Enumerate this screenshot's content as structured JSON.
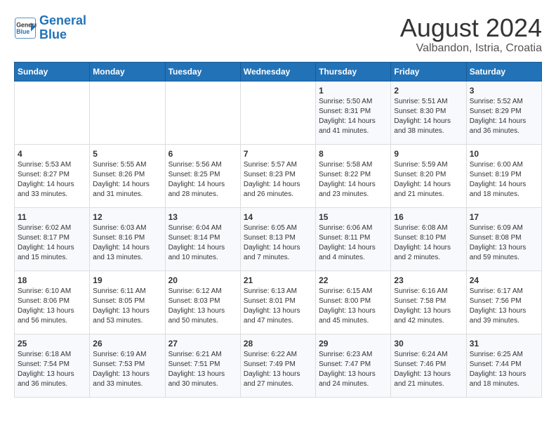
{
  "header": {
    "logo_line1": "General",
    "logo_line2": "Blue",
    "title": "August 2024",
    "subtitle": "Valbandon, Istria, Croatia"
  },
  "weekdays": [
    "Sunday",
    "Monday",
    "Tuesday",
    "Wednesday",
    "Thursday",
    "Friday",
    "Saturday"
  ],
  "weeks": [
    [
      {
        "day": "",
        "content": ""
      },
      {
        "day": "",
        "content": ""
      },
      {
        "day": "",
        "content": ""
      },
      {
        "day": "",
        "content": ""
      },
      {
        "day": "1",
        "content": "Sunrise: 5:50 AM\nSunset: 8:31 PM\nDaylight: 14 hours\nand 41 minutes."
      },
      {
        "day": "2",
        "content": "Sunrise: 5:51 AM\nSunset: 8:30 PM\nDaylight: 14 hours\nand 38 minutes."
      },
      {
        "day": "3",
        "content": "Sunrise: 5:52 AM\nSunset: 8:29 PM\nDaylight: 14 hours\nand 36 minutes."
      }
    ],
    [
      {
        "day": "4",
        "content": "Sunrise: 5:53 AM\nSunset: 8:27 PM\nDaylight: 14 hours\nand 33 minutes."
      },
      {
        "day": "5",
        "content": "Sunrise: 5:55 AM\nSunset: 8:26 PM\nDaylight: 14 hours\nand 31 minutes."
      },
      {
        "day": "6",
        "content": "Sunrise: 5:56 AM\nSunset: 8:25 PM\nDaylight: 14 hours\nand 28 minutes."
      },
      {
        "day": "7",
        "content": "Sunrise: 5:57 AM\nSunset: 8:23 PM\nDaylight: 14 hours\nand 26 minutes."
      },
      {
        "day": "8",
        "content": "Sunrise: 5:58 AM\nSunset: 8:22 PM\nDaylight: 14 hours\nand 23 minutes."
      },
      {
        "day": "9",
        "content": "Sunrise: 5:59 AM\nSunset: 8:20 PM\nDaylight: 14 hours\nand 21 minutes."
      },
      {
        "day": "10",
        "content": "Sunrise: 6:00 AM\nSunset: 8:19 PM\nDaylight: 14 hours\nand 18 minutes."
      }
    ],
    [
      {
        "day": "11",
        "content": "Sunrise: 6:02 AM\nSunset: 8:17 PM\nDaylight: 14 hours\nand 15 minutes."
      },
      {
        "day": "12",
        "content": "Sunrise: 6:03 AM\nSunset: 8:16 PM\nDaylight: 14 hours\nand 13 minutes."
      },
      {
        "day": "13",
        "content": "Sunrise: 6:04 AM\nSunset: 8:14 PM\nDaylight: 14 hours\nand 10 minutes."
      },
      {
        "day": "14",
        "content": "Sunrise: 6:05 AM\nSunset: 8:13 PM\nDaylight: 14 hours\nand 7 minutes."
      },
      {
        "day": "15",
        "content": "Sunrise: 6:06 AM\nSunset: 8:11 PM\nDaylight: 14 hours\nand 4 minutes."
      },
      {
        "day": "16",
        "content": "Sunrise: 6:08 AM\nSunset: 8:10 PM\nDaylight: 14 hours\nand 2 minutes."
      },
      {
        "day": "17",
        "content": "Sunrise: 6:09 AM\nSunset: 8:08 PM\nDaylight: 13 hours\nand 59 minutes."
      }
    ],
    [
      {
        "day": "18",
        "content": "Sunrise: 6:10 AM\nSunset: 8:06 PM\nDaylight: 13 hours\nand 56 minutes."
      },
      {
        "day": "19",
        "content": "Sunrise: 6:11 AM\nSunset: 8:05 PM\nDaylight: 13 hours\nand 53 minutes."
      },
      {
        "day": "20",
        "content": "Sunrise: 6:12 AM\nSunset: 8:03 PM\nDaylight: 13 hours\nand 50 minutes."
      },
      {
        "day": "21",
        "content": "Sunrise: 6:13 AM\nSunset: 8:01 PM\nDaylight: 13 hours\nand 47 minutes."
      },
      {
        "day": "22",
        "content": "Sunrise: 6:15 AM\nSunset: 8:00 PM\nDaylight: 13 hours\nand 45 minutes."
      },
      {
        "day": "23",
        "content": "Sunrise: 6:16 AM\nSunset: 7:58 PM\nDaylight: 13 hours\nand 42 minutes."
      },
      {
        "day": "24",
        "content": "Sunrise: 6:17 AM\nSunset: 7:56 PM\nDaylight: 13 hours\nand 39 minutes."
      }
    ],
    [
      {
        "day": "25",
        "content": "Sunrise: 6:18 AM\nSunset: 7:54 PM\nDaylight: 13 hours\nand 36 minutes."
      },
      {
        "day": "26",
        "content": "Sunrise: 6:19 AM\nSunset: 7:53 PM\nDaylight: 13 hours\nand 33 minutes."
      },
      {
        "day": "27",
        "content": "Sunrise: 6:21 AM\nSunset: 7:51 PM\nDaylight: 13 hours\nand 30 minutes."
      },
      {
        "day": "28",
        "content": "Sunrise: 6:22 AM\nSunset: 7:49 PM\nDaylight: 13 hours\nand 27 minutes."
      },
      {
        "day": "29",
        "content": "Sunrise: 6:23 AM\nSunset: 7:47 PM\nDaylight: 13 hours\nand 24 minutes."
      },
      {
        "day": "30",
        "content": "Sunrise: 6:24 AM\nSunset: 7:46 PM\nDaylight: 13 hours\nand 21 minutes."
      },
      {
        "day": "31",
        "content": "Sunrise: 6:25 AM\nSunset: 7:44 PM\nDaylight: 13 hours\nand 18 minutes."
      }
    ]
  ]
}
